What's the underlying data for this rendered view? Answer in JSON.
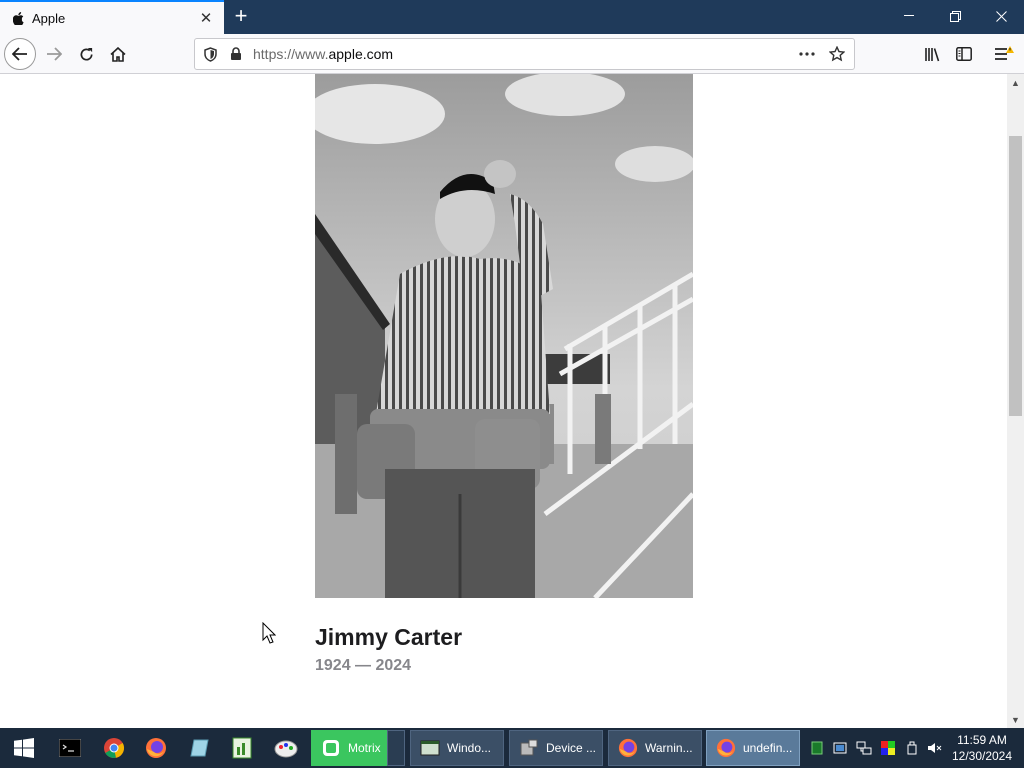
{
  "browser": {
    "tab": {
      "title": "Apple",
      "favicon": "apple-logo-icon"
    },
    "url": {
      "prefix": "https://www.",
      "host": "apple.com",
      "suffix": ""
    }
  },
  "page": {
    "name": "Jimmy Carter",
    "dates": "1924 — 2024",
    "photo_description_icon": "portrait-photo"
  },
  "taskbar": {
    "pinned": [
      "start-icon",
      "terminal-icon",
      "chrome-icon",
      "firefox-icon",
      "notes-icon",
      "spreadsheet-icon",
      "paint-icon"
    ],
    "tasks": [
      {
        "label": "Motrix",
        "icon": "motrix-icon"
      },
      {
        "label": "",
        "icon": ""
      },
      {
        "label": "Windo...",
        "icon": "window-icon"
      },
      {
        "label": "Device ...",
        "icon": "device-icon"
      },
      {
        "label": "Warnin...",
        "icon": "firefox-icon"
      },
      {
        "label": "undefin...",
        "icon": "firefox-icon"
      }
    ],
    "clock": {
      "time": "11:59 AM",
      "date": "12/30/2024"
    }
  },
  "colors": {
    "tab_accent": "#0a84ff",
    "titlebar": "#1f3a5a",
    "taskbar": "#1b2a3c",
    "motrix_green": "#3bc65f"
  }
}
